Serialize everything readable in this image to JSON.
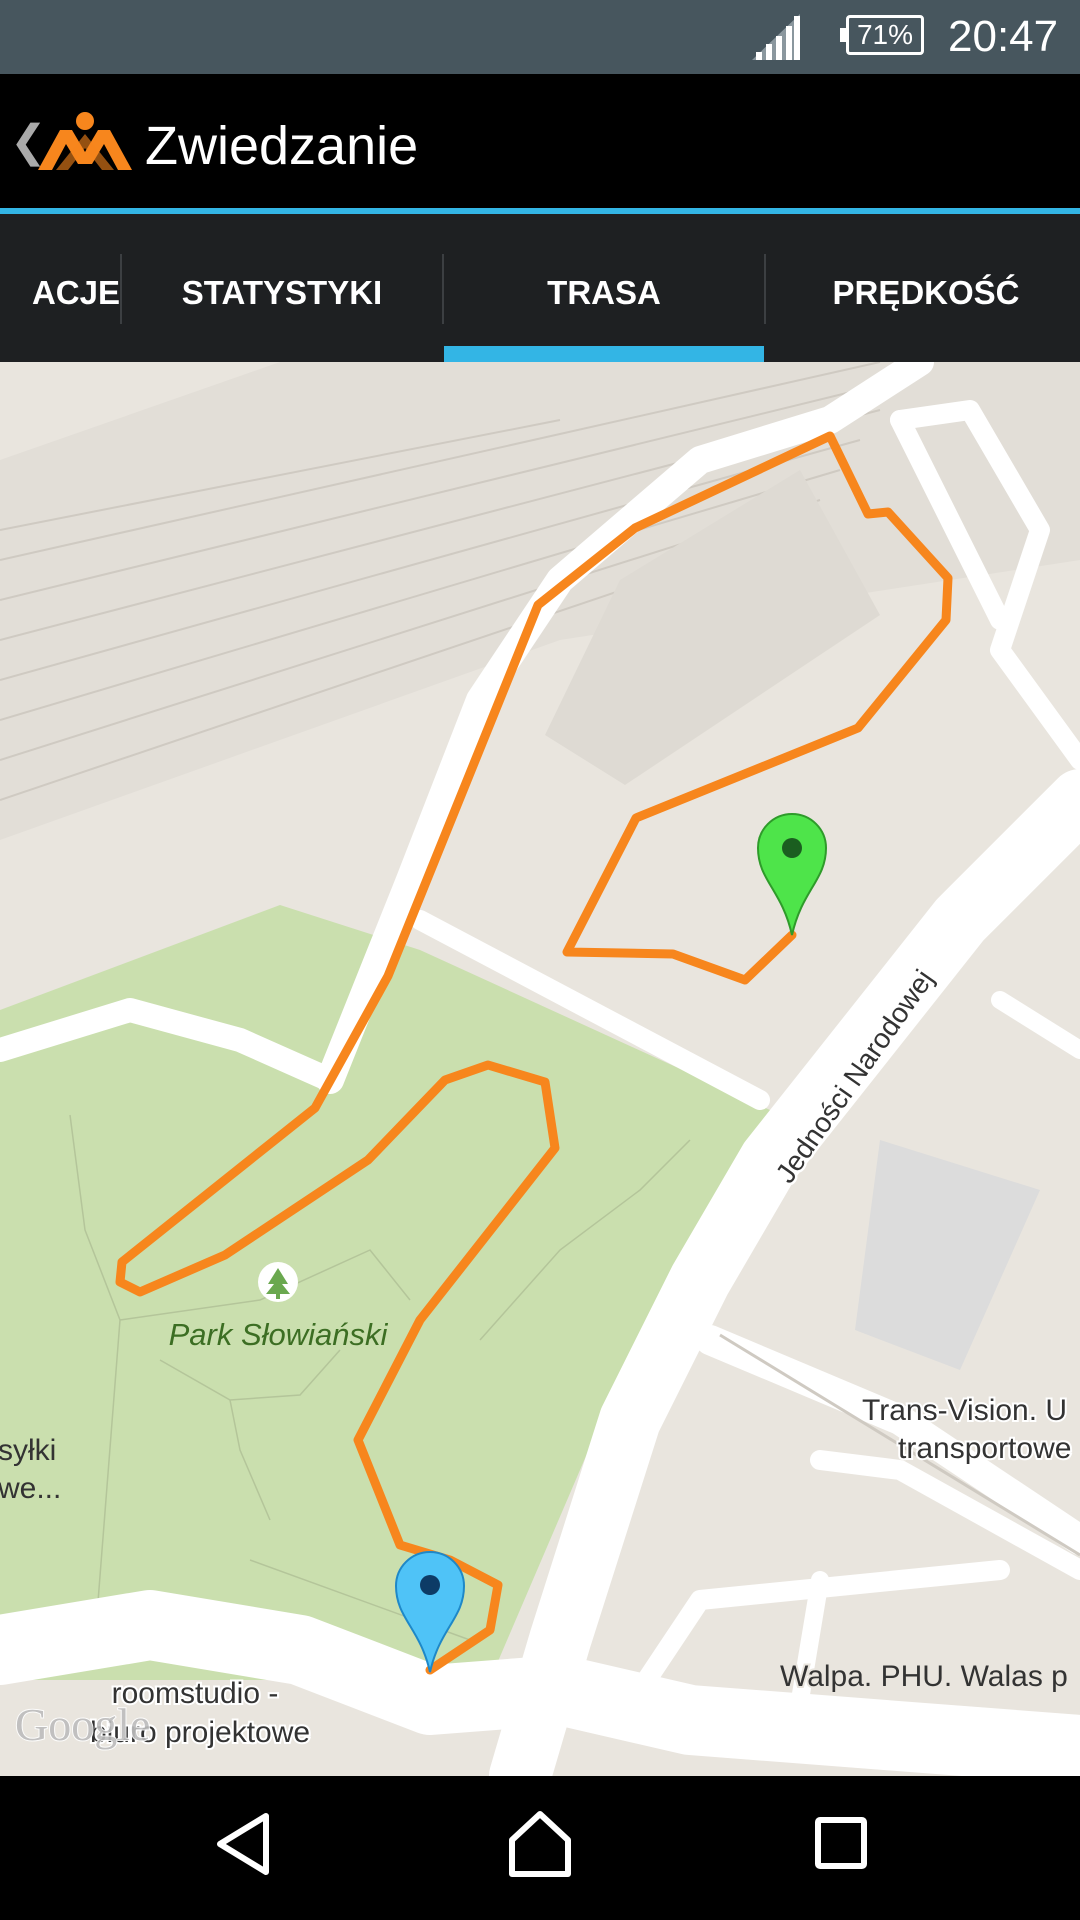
{
  "status_bar": {
    "battery": "71%",
    "time": "20:47",
    "icons": [
      "signal-icon",
      "battery-icon"
    ]
  },
  "action_bar": {
    "back_icon": "chevron-left-icon",
    "logo": "app-logo",
    "title": "Zwiedzanie"
  },
  "tabs": [
    {
      "label": "ACJE",
      "selected": false
    },
    {
      "label": "STATYSTYKI",
      "selected": false
    },
    {
      "label": "TRASA",
      "selected": true
    },
    {
      "label": "PRĘDKOŚĆ",
      "selected": false
    }
  ],
  "map": {
    "street_label": "Jedności Narodowej",
    "park_label": "Park Słowiański",
    "poi_labels": {
      "left_line1": "syłki",
      "left_line2": "we...",
      "trans_line1": "Trans-Vision. U",
      "trans_line2": "transportowe",
      "roomstudio_line1": "roomstudio -",
      "roomstudio_line2": "biuro projektowe",
      "walpa": "Walpa. PHU. Walas p"
    },
    "attribution": "Google",
    "route_color": "#f7861d",
    "start_marker_color": "#4fc3f7",
    "end_marker_color": "#4ee44a",
    "park_color": "#cadfae",
    "land_color": "#e9e5de"
  },
  "nav_bar": {
    "icons": [
      "back-triangle-icon",
      "home-icon",
      "recents-icon"
    ]
  }
}
